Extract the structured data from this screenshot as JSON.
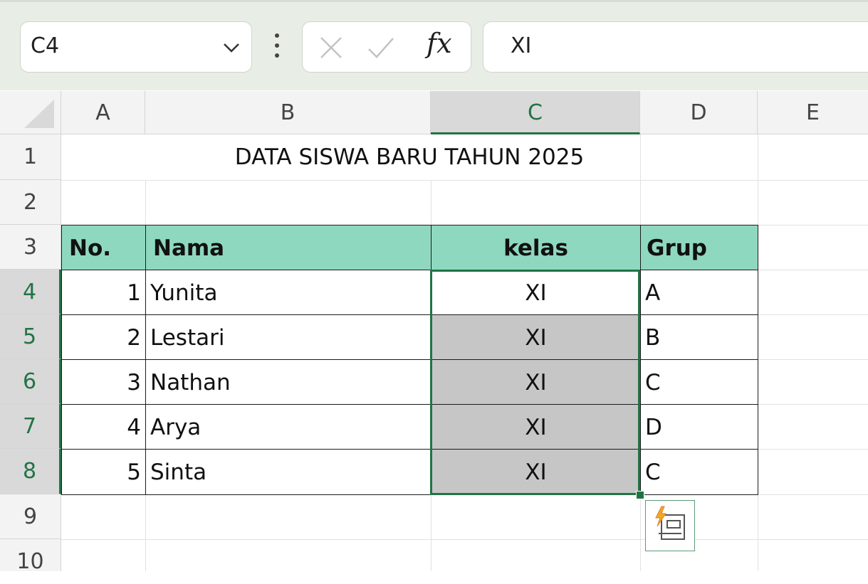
{
  "toolbar": {
    "name_box": "C4",
    "fx_label": "fx",
    "formula_value": "XI"
  },
  "columns": [
    "A",
    "B",
    "C",
    "D",
    "E"
  ],
  "rows": [
    "1",
    "2",
    "3",
    "4",
    "5",
    "6",
    "7",
    "8",
    "9",
    "10"
  ],
  "selected": {
    "column": "C",
    "row": "4"
  },
  "sheet": {
    "title": "DATA SISWA BARU TAHUN 2025",
    "headers": {
      "no": "No.",
      "nama": "Nama",
      "kelas": "kelas",
      "grup": "Grup"
    },
    "records": [
      {
        "no": "1",
        "nama": "Yunita",
        "kelas": "XI",
        "grup": "A"
      },
      {
        "no": "2",
        "nama": "Lestari",
        "kelas": "XI",
        "grup": "B"
      },
      {
        "no": "3",
        "nama": "Nathan",
        "kelas": "XI",
        "grup": "C"
      },
      {
        "no": "4",
        "nama": "Arya",
        "kelas": "XI",
        "grup": "D"
      },
      {
        "no": "5",
        "nama": "Sinta",
        "kelas": "XI",
        "grup": "C"
      }
    ]
  },
  "colors": {
    "header_fill": "#8fd8c0",
    "fill_gray": "#c6c6c6",
    "selection": "#217346",
    "toolbar_bg": "#e8ede6"
  },
  "icons": {
    "dropdown": "chevron-down-icon",
    "more": "vertical-dots-icon",
    "cancel": "x-icon",
    "enter": "check-icon",
    "quick_analysis": "quick-analysis-icon"
  }
}
